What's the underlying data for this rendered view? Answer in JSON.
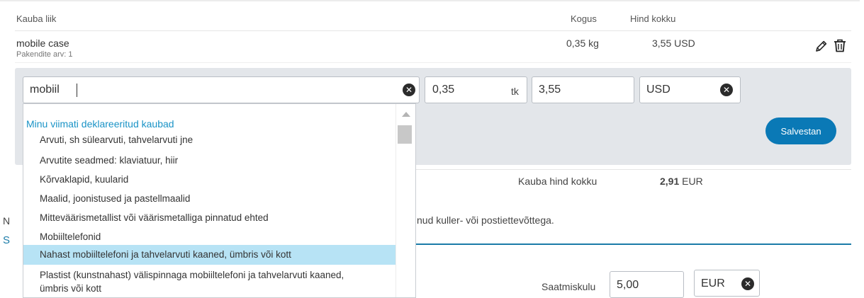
{
  "table": {
    "headers": {
      "type": "Kauba liik",
      "qty": "Kogus",
      "total": "Hind kokku"
    },
    "item": {
      "name": "mobile case",
      "packages": "Pakendite arv: 1",
      "qty": "0,35 kg",
      "price": "3,55 USD"
    }
  },
  "editor": {
    "search_value": "mobiil",
    "quantity_value": "0,35",
    "quantity_unit": "tk",
    "price_value": "3,55",
    "currency_value": "USD",
    "save_label": "Salvestan"
  },
  "dropdown": {
    "heading": "Minu viimati deklareeritud kaubad",
    "items": [
      "Arvuti, sh sülearvuti, tahvelarvuti jne",
      "Arvutite seadmed: klaviatuur, hiir",
      "Kõrvaklapid, kuularid",
      "Maalid, joonistused ja pastellmaalid",
      "Mitteväärismetallist või väärismetalliga pinnatud ehted",
      "Mobiiltelefonid",
      "Nahast mobiiltelefoni ja tahvelarvuti kaaned, ümbris või kott",
      "Plastist (kunstnahast) välispinnaga mobiiltelefoni ja tahvelarvuti kaaned,",
      "ümbris või kott"
    ],
    "highlighted_index": 6
  },
  "summary": {
    "label": "Kauba hind kokku",
    "amount": "2,91",
    "currency": "EUR"
  },
  "partial_text": {
    "n_letter": "N",
    "s_letter": "S",
    "courier_text": "nud kuller- või postiettevõttega."
  },
  "shipping": {
    "label": "Saatmiskulu",
    "value": "5,00",
    "currency": "EUR"
  },
  "icons": {
    "edit": "pencil-icon",
    "delete": "trash-icon",
    "clear": "clear-x-icon"
  },
  "colors": {
    "accent": "#0a79b6",
    "highlight": "#b7e3f5",
    "heading_blue": "#1a93c6",
    "panel": "#e3e6ea"
  }
}
